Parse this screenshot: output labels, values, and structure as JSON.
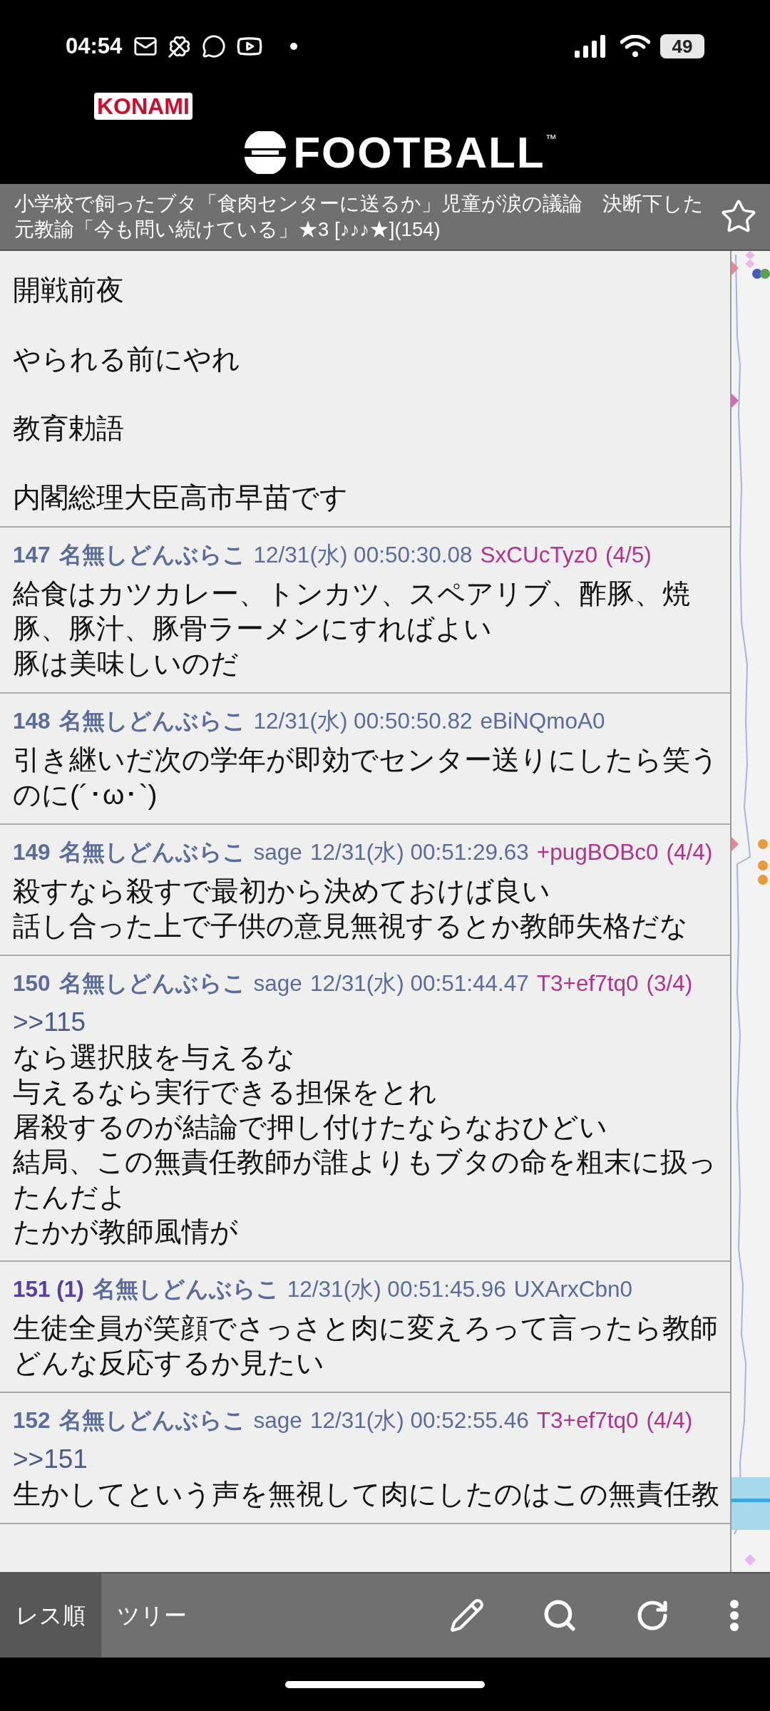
{
  "status_bar": {
    "time": "04:54",
    "battery": "49"
  },
  "ad_banner": {
    "brand": "KONAMI",
    "title": "FOOTBALL",
    "trademark": "™"
  },
  "thread": {
    "title": "小学校で飼ったブタ「食肉センターに送るか」児童が涙の議論　決断下した元教諭「今も問い続けている」★3 [♪♪♪★](154)",
    "favorite": false
  },
  "posts": [
    {
      "paragraph_gap": true,
      "body": [
        {
          "kind": "text",
          "text": "開戦前夜"
        },
        {
          "kind": "text",
          "text": "やられる前にやれ"
        },
        {
          "kind": "text",
          "text": "教育勅語"
        },
        {
          "kind": "text",
          "text": "内閣総理大臣高市早苗です"
        }
      ]
    },
    {
      "number": "147",
      "name": "名無しどんぶらこ",
      "date": "12/31(水) 00:50:30.08",
      "id": "SxCUcTyz0",
      "id_count": "(4/5)",
      "body": [
        {
          "kind": "text",
          "text": "給食はカツカレー、トンカツ、スペアリブ、酢豚、焼豚、豚汁、豚骨ラーメンにすればよい"
        },
        {
          "kind": "text",
          "text": "豚は美味しいのだ"
        }
      ]
    },
    {
      "number": "148",
      "name": "名無しどんぶらこ",
      "date": "12/31(水) 00:50:50.82",
      "id": "eBiNQmoA0",
      "body": [
        {
          "kind": "text",
          "text": "引き継いだ次の学年が即効でセンター送りにしたら笑うのに(´･ω･`)"
        }
      ]
    },
    {
      "number": "149",
      "name": "名無しどんぶらこ",
      "mail": "sage",
      "date": "12/31(水) 00:51:29.63",
      "id": "+pugBOBc0",
      "id_count": "(4/4)",
      "body": [
        {
          "kind": "text",
          "text": "殺すなら殺すで最初から決めておけば良い"
        },
        {
          "kind": "text",
          "text": "話し合った上で子供の意見無視するとか教師失格だな"
        }
      ]
    },
    {
      "number": "150",
      "name": "名無しどんぶらこ",
      "mail": "sage",
      "date": "12/31(水) 00:51:44.47",
      "id": "T3+ef7tq0",
      "id_count": "(3/4)",
      "body": [
        {
          "kind": "anchor",
          "text": ">>115"
        },
        {
          "kind": "text",
          "text": "なら選択肢を与えるな"
        },
        {
          "kind": "text",
          "text": "与えるなら実行できる担保をとれ"
        },
        {
          "kind": "text",
          "text": "屠殺するのが結論で押し付けたならなおひどい"
        },
        {
          "kind": "text",
          "text": "結局、この無責任教師が誰よりもブタの命を粗末に扱ったんだよ"
        },
        {
          "kind": "text",
          "text": "たかが教師風情が"
        }
      ]
    },
    {
      "number": "151",
      "reply_count": "(1)",
      "name": "名無しどんぶらこ",
      "date": "12/31(水) 00:51:45.96",
      "id": "UXArxCbn0",
      "body": [
        {
          "kind": "text",
          "text": "生徒全員が笑顔でさっさと肉に変えろって言ったら教師どんな反応するか見たい"
        }
      ]
    },
    {
      "number": "152",
      "name": "名無しどんぶらこ",
      "mail": "sage",
      "date": "12/31(水) 00:52:55.46",
      "id": "T3+ef7tq0",
      "id_count": "(4/4)",
      "body": [
        {
          "kind": "anchor",
          "text": ">>151"
        },
        {
          "kind": "text",
          "text": "生かしてという声を無視して肉にしたのはこの無責任教"
        }
      ]
    }
  ],
  "bottom_bar": {
    "tabs": [
      {
        "label": "レス順",
        "selected": true
      },
      {
        "label": "ツリー",
        "selected": false
      }
    ]
  }
}
